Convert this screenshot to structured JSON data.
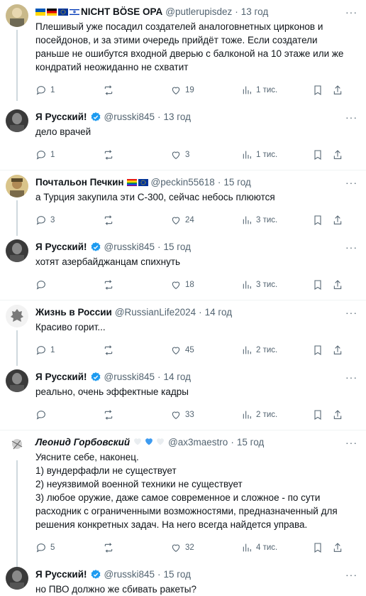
{
  "colors": {
    "verified": "#1d9bf0",
    "muted": "#536471",
    "text": "#0f1419"
  },
  "tweets": [
    {
      "name": "NICHT BÖSE OPA",
      "handle": "@putlerupisdez",
      "time": "13 год",
      "badges": [
        "ukraine-flag",
        "germany-flag",
        "eu-flag",
        "israel-flag"
      ],
      "text": "Плешивый уже посадил создателей аналоговнетных цирконов и посейдонов, и за этими очередь прийдёт тоже. Если создатели раньше не ошибутся  входной дверью с балконой на 10 этаже или же кондратий неожиданно не схватит",
      "replies": "1",
      "retweets": "",
      "likes": "19",
      "views": "1 тис."
    },
    {
      "name": "Я Русский!",
      "handle": "@russki845",
      "time": "13 год",
      "verified": true,
      "text": "дело врачей",
      "replies": "1",
      "retweets": "",
      "likes": "3",
      "views": "1 тис."
    },
    {
      "name": "Почтальон Печкин",
      "handle": "@peckin55618",
      "time": "15 год",
      "badges": [
        "rainbow-flag",
        "eu-flag"
      ],
      "text": "а Турция закупила эти С-300, сейчас небось плюются",
      "replies": "3",
      "retweets": "",
      "likes": "24",
      "views": "3 тис."
    },
    {
      "name": "Я Русский!",
      "handle": "@russki845",
      "time": "15 год",
      "verified": true,
      "text": "хотят азербайджанцам спихнуть",
      "replies": "",
      "retweets": "",
      "likes": "18",
      "views": "3 тис."
    },
    {
      "name": "Жизнь в России",
      "handle": "@RussianLife2024",
      "time": "14 год",
      "text": "Красиво горит...",
      "replies": "1",
      "retweets": "",
      "likes": "45",
      "views": "2 тис."
    },
    {
      "name": "Я Русский!",
      "handle": "@russki845",
      "time": "14 год",
      "verified": true,
      "text": "реально, очень эффектные кадры",
      "replies": "",
      "retweets": "",
      "likes": "33",
      "views": "2 тис."
    },
    {
      "name": "Леонид Горбовский",
      "handle": "@ax3maestro",
      "time": "15 год",
      "badges": [
        "white-heart",
        "blue-heart",
        "white-heart"
      ],
      "text_lines": [
        "Уясните себе, наконец.",
        "1) вундерфафли не существует",
        "2) неуязвимой военной техники не существует",
        "3) любое оружие, даже самое современное и сложное - по сути расходник с ограниченными возможностями, предназначенный для решения конкретных задач. На него всегда найдется управа."
      ],
      "replies": "5",
      "retweets": "",
      "likes": "32",
      "views": "4 тис."
    },
    {
      "name": "Я Русский!",
      "handle": "@russki845",
      "time": "15 год",
      "verified": true,
      "text": "но ПВО должно же сбивать ракеты?"
    }
  ],
  "more_glyph": "···",
  "dot": "·"
}
